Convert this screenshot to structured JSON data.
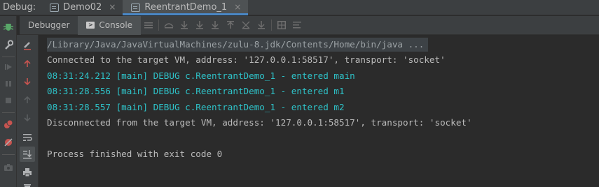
{
  "debug_tabs": {
    "title": "Debug:",
    "tabs": [
      {
        "label": "Demo02",
        "close": "×"
      },
      {
        "label": "ReentrantDemo_1",
        "close": "×"
      }
    ]
  },
  "toolbar": {
    "debugger_label": "Debugger",
    "console_label": "Console"
  },
  "console": {
    "lines": [
      {
        "text": "/Library/Java/JavaVirtualMachines/zulu-8.jdk/Contents/Home/bin/java ...",
        "style": "cmd"
      },
      {
        "text": "Connected to the target VM, address: '127.0.0.1:58517', transport: 'socket'",
        "style": "plain"
      },
      {
        "text": "08:31:24.212 [main] DEBUG c.ReentrantDemo_1 - entered main",
        "style": "cyan"
      },
      {
        "text": "08:31:28.556 [main] DEBUG c.ReentrantDemo_1 - entered m1",
        "style": "cyan"
      },
      {
        "text": "08:31:28.557 [main] DEBUG c.ReentrantDemo_1 - entered m2",
        "style": "cyan"
      },
      {
        "text": "Disconnected from the target VM, address: '127.0.0.1:58517', transport: 'socket'",
        "style": "plain"
      },
      {
        "text": "",
        "style": "plain"
      },
      {
        "text": "Process finished with exit code 0",
        "style": "plain"
      }
    ]
  },
  "colors": {
    "accent_tab_underline": "#4a88c7",
    "cyan_log": "#2ec3c9",
    "resume_green": "#59a869",
    "stop_red": "#c75450"
  },
  "icons": {
    "debug_tab": "bug-icon",
    "left_gutter": [
      "bug-icon",
      "wrench-icon",
      "rerun-icon",
      "resume-icon",
      "pause-icon",
      "stop-icon",
      "view-breakpoints-icon",
      "mute-breakpoints-icon",
      "camera-icon"
    ],
    "inner_gutter": [
      "clear-icon",
      "up-arrow-icon",
      "down-arrow-icon",
      "up-arrow-icon",
      "down-arrow-icon",
      "soft-wrap-icon",
      "scroll-to-end-icon",
      "print-icon",
      "trash-icon"
    ],
    "toolbar": [
      "console-icon",
      "menu-icon",
      "show-execution-point-icon",
      "step-over-icon",
      "step-into-icon",
      "force-step-into-icon",
      "step-out-icon",
      "drop-frame-icon",
      "run-to-cursor-icon",
      "evaluate-icon",
      "table-icon",
      "trace-icon"
    ]
  }
}
